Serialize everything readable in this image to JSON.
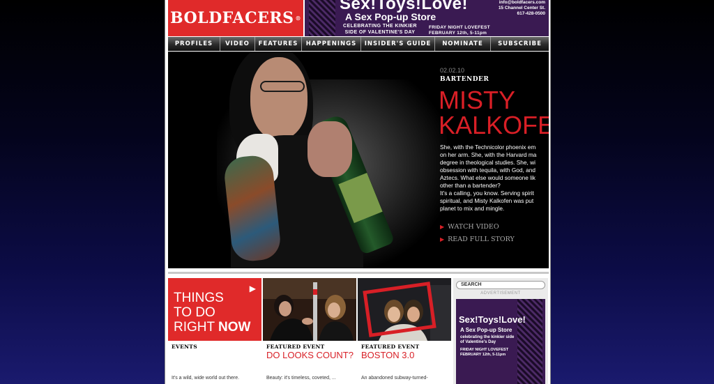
{
  "header": {
    "logo": "BOLDFACERS",
    "ad": {
      "headline": "Sex!Toys!Love!",
      "subhead": "A Sex Pop-up Store",
      "tagline": "CELEBRATING THE KINKIER SIDE OF VALENTINE'S DAY",
      "event_line1": "FRIDAY NIGHT LOVEFEST",
      "event_line2": "FEBRUARY 12th, 5-11pm",
      "email": "info@boldfacers.com",
      "address": "15 Channel Center St.",
      "phone": "617-428-0500"
    }
  },
  "nav": [
    "PROFILES",
    "VIDEO",
    "FEATURES",
    "HAPPENINGS",
    "INSIDER'S GUIDE",
    "NOMINATE",
    "SUBSCRIBE"
  ],
  "hero": {
    "date": "02.02.10",
    "role": "BARTENDER",
    "name_line1": "MISTY",
    "name_line2": "KALKOFEN",
    "bio": "She, with the Technicolor phoenix em\non her arm. She, with the Harvard ma\ndegree in theological studies. She, wi\nobsession with tequila, with God, and\nAztecs. What else would someone lik\nother than a bartender?\nIt's a calling, you know. Serving spirit\nspiritual, and Misty Kalkofen was put\nplanet to mix and mingle.",
    "watch_video": "WATCH VIDEO",
    "read_story": "READ FULL STORY"
  },
  "tiles": [
    {
      "category": "EVENTS",
      "title_plain": "THINGS\nTO DO\nRIGHT ",
      "title_bold": "NOW",
      "text": "It's a wild, wide world out there."
    },
    {
      "category": "FEATURED EVENT",
      "title": "DO LOOKS COUNT?",
      "text": "Beauty: it's timeless, coveted, ..."
    },
    {
      "category": "FEATURED EVENT",
      "title": "BOSTON 3.0",
      "text": "An abandoned subway-turned-"
    }
  ],
  "sidebar": {
    "search_placeholder": "SEARCH",
    "ad_label": "ADVERTISEMENT",
    "ad": {
      "headline": "Sex!Toys!Love!",
      "subhead": "A Sex Pop-up Store",
      "tagline": "celebrating the kinkier side of Valentine's Day",
      "event_line1": "FRIDAY NIGHT LOVEFEST",
      "event_line2": "FEBRUARY 12th, 5-11pm"
    }
  },
  "colors": {
    "brand_red": "#e02a2a",
    "name_red": "#d81f26",
    "ad_purple": "#3a1a52"
  }
}
